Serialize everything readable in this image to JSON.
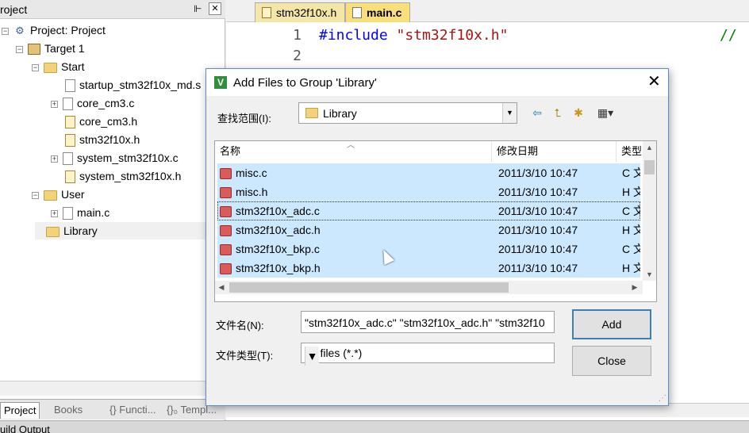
{
  "left_panel": {
    "title": "roject",
    "pin": "⊩",
    "close": "✕",
    "tree": {
      "project": "Project: Project",
      "target": "Target 1",
      "group_start": "Start",
      "start_files": [
        "startup_stm32f10x_md.s",
        "core_cm3.c",
        "core_cm3.h",
        "stm32f10x.h",
        "system_stm32f10x.c",
        "system_stm32f10x.h"
      ],
      "group_user": "User",
      "user_files": [
        "main.c"
      ],
      "group_library": "Library"
    },
    "tabs": [
      "Project",
      "Books",
      "{} Functi...",
      "{}₀ Templ..."
    ]
  },
  "bottom_strip": "uild Output",
  "editor": {
    "tabs": [
      "stm32f10x.h",
      "main.c"
    ],
    "active_tab": "main.c",
    "line_numbers": [
      "1",
      "2"
    ],
    "line1_directive": "#include",
    "line1_string": "\"stm32f10x.h\"",
    "line1_comment": "//"
  },
  "dialog": {
    "title": "Add Files to Group 'Library'",
    "close": "✕",
    "look_in_label": "查找范围(I):",
    "look_in_value": "Library",
    "toolbar_icons": [
      "back-icon",
      "up-folder-icon",
      "new-folder-icon",
      "view-menu-icon"
    ],
    "columns": {
      "name": "名称",
      "date": "修改日期",
      "type": "类型"
    },
    "files": [
      {
        "name": "misc.c",
        "date": "2011/3/10 10:47",
        "type": "C 文"
      },
      {
        "name": "misc.h",
        "date": "2011/3/10 10:47",
        "type": "H 文"
      },
      {
        "name": "stm32f10x_adc.c",
        "date": "2011/3/10 10:47",
        "type": "C 文"
      },
      {
        "name": "stm32f10x_adc.h",
        "date": "2011/3/10 10:47",
        "type": "H 文"
      },
      {
        "name": "stm32f10x_bkp.c",
        "date": "2011/3/10 10:47",
        "type": "C 文"
      },
      {
        "name": "stm32f10x_bkp.h",
        "date": "2011/3/10 10:47",
        "type": "H 文"
      }
    ],
    "file_name_label": "文件名(N):",
    "file_name_value": "\"stm32f10x_adc.c\" \"stm32f10x_adc.h\" \"stm32f10",
    "file_type_label": "文件类型(T):",
    "file_type_value": "All files (*.*)",
    "add_button": "Add",
    "close_button": "Close"
  },
  "colors": {
    "selection": "#cce8ff",
    "dialog_border": "#5c8cc7",
    "add_button_border": "#3c7fb1"
  }
}
